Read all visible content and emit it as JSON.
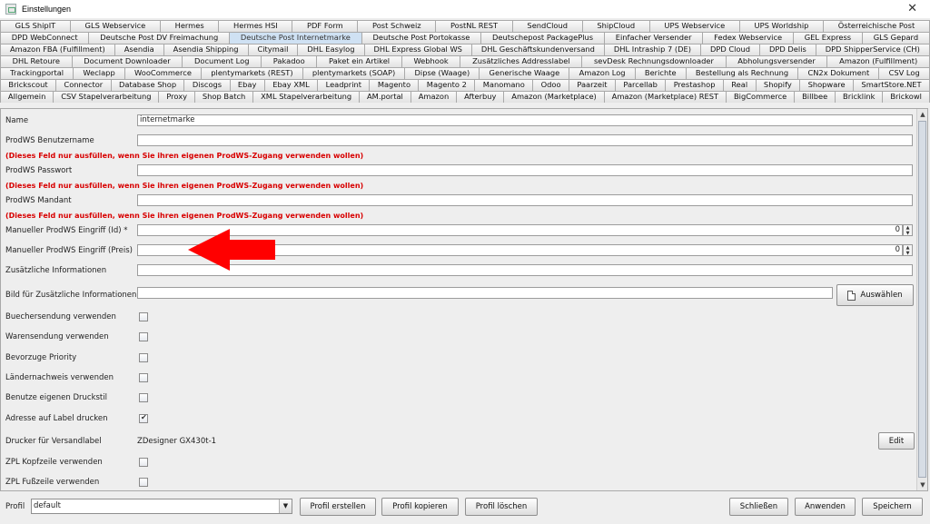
{
  "window": {
    "title": "Einstellungen",
    "close_glyph": "✕"
  },
  "tabs": [
    [
      "GLS ShipIT",
      "GLS Webservice",
      "Hermes",
      "Hermes HSI",
      "PDF Form",
      "Post Schweiz",
      "PostNL REST",
      "SendCloud",
      "ShipCloud",
      "UPS Webservice",
      "UPS Worldship",
      "Österreichische Post"
    ],
    [
      "DPD WebConnect",
      "Deutsche Post DV Freimachung",
      "Deutsche Post Internetmarke",
      "Deutsche Post Portokasse",
      "Deutschepost PackagePlus",
      "Einfacher Versender",
      "Fedex Webservice",
      "GEL Express",
      "GLS Gepard"
    ],
    [
      "Amazon FBA (Fulfillment)",
      "Asendia",
      "Asendia Shipping",
      "Citymail",
      "DHL Easylog",
      "DHL Express Global WS",
      "DHL Geschäftskundenversand",
      "DHL Intraship 7 (DE)",
      "DPD Cloud",
      "DPD Delis",
      "DPD ShipperService (CH)"
    ],
    [
      "DHL Retoure",
      "Document Downloader",
      "Document Log",
      "Pakadoo",
      "Paket ein Artikel",
      "Webhook",
      "Zusätzliches Addresslabel",
      "sevDesk Rechnungsdownloader",
      "Abholungsversender",
      "Amazon (Fulfillment)"
    ],
    [
      "Trackingportal",
      "Weclapp",
      "WooCommerce",
      "plentymarkets (REST)",
      "plentymarkets (SOAP)",
      "Dipse (Waage)",
      "Generische Waage",
      "Amazon Log",
      "Berichte",
      "Bestellung als Rechnung",
      "CN2x Dokument",
      "CSV Log"
    ],
    [
      "Brickscout",
      "Connector",
      "Database Shop",
      "Discogs",
      "Ebay",
      "Ebay XML",
      "Leadprint",
      "Magento",
      "Magento 2",
      "Manomano",
      "Odoo",
      "Paarzeit",
      "Parcellab",
      "Prestashop",
      "Real",
      "Shopify",
      "Shopware",
      "SmartStore.NET"
    ],
    [
      "Allgemein",
      "CSV Stapelverarbeitung",
      "Proxy",
      "Shop Batch",
      "XML Stapelverarbeitung",
      "AM.portal",
      "Amazon",
      "Afterbuy",
      "Amazon (Marketplace)",
      "Amazon (Marketplace) REST",
      "BigCommerce",
      "Billbee",
      "Bricklink",
      "Brickowl"
    ]
  ],
  "active_tab": "Deutsche Post Internetmarke",
  "form": {
    "name_label": "Name",
    "name_value": "internetmarke",
    "prodws_user_label": "ProdWS Benutzername",
    "warning": "(Dieses Feld nur ausfüllen, wenn Sie ihren eigenen ProdWS-Zugang verwenden wollen)",
    "prodws_pass_label": "ProdWS Passwort",
    "prodws_mandant_label": "ProdWS Mandant",
    "manual_id_label": "Manueller ProdWS Eingriff (Id) *",
    "manual_id_value": "0",
    "manual_price_label": "Manueller ProdWS Eingriff (Preis)",
    "manual_price_value": "0",
    "extra_info_label": "Zusätzliche Informationen",
    "image_label": "Bild für Zusätzliche Informationen",
    "choose_button": "Auswählen",
    "buecher_label": "Buechersendung verwenden",
    "waren_label": "Warensendung verwenden",
    "priority_label": "Bevorzuge Priority",
    "laender_label": "Ländernachweis verwenden",
    "druckstil_label": "Benutze eigenen Druckstil",
    "adresse_label": "Adresse auf Label drucken",
    "adresse_checked": true,
    "drucker_label": "Drucker für Versandlabel",
    "drucker_value": "ZDesigner GX430t-1",
    "edit_button": "Edit",
    "zpl_kopf_label": "ZPL Kopfzeile verwenden",
    "zpl_fuss_label": "ZPL Fußzeile verwenden"
  },
  "spinner": {
    "up": "▲",
    "down": "▼"
  },
  "scroll": {
    "up": "▲",
    "down": "▼"
  },
  "annotation": {
    "arrow_color": "#ff0000"
  },
  "bottom": {
    "profil_label": "Profil",
    "profil_value": "default",
    "dropdown_glyph": "▼",
    "create": "Profil erstellen",
    "copy": "Profil kopieren",
    "delete": "Profil löschen",
    "close": "Schließen",
    "apply": "Anwenden",
    "save": "Speichern"
  }
}
